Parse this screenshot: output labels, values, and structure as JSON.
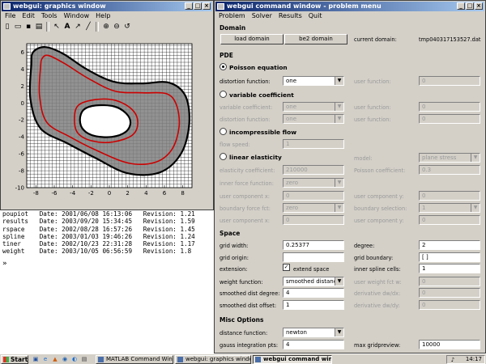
{
  "graphics_window": {
    "title": "webgui: graphics window",
    "menu": [
      "File",
      "Edit",
      "Tools",
      "Window",
      "Help"
    ],
    "toolbar_icons": [
      "new-file-icon",
      "open-folder-icon",
      "save-icon",
      "print-icon",
      "arrow-icon",
      "text-icon",
      "arrow-line-icon",
      "line-icon",
      "zoom-in-icon",
      "zoom-out-icon",
      "rotate-icon"
    ]
  },
  "command_window": {
    "rows": [
      "poupiot   Date: 2001/06/08 16:13:06   Revision: 1.21",
      "results   Date: 2003/09/20 15:34:45   Revision: 1.59",
      "rspace    Date: 2002/08/28 16:57:26   Revision: 1.45",
      "spline    Date: 2003/01/03 19:46:26   Revision: 1.24",
      "tiner     Date: 2002/10/23 22:31:28   Revision: 1.17",
      "weight    Date: 2003/10/05 06:56:59   Revision: 1.8"
    ],
    "prompt": "»"
  },
  "problem_menu": {
    "title": "webgui command window - problem menu",
    "menu": [
      "Problem",
      "Solver",
      "Results",
      "Quit"
    ],
    "domain": {
      "heading": "Domain",
      "load_button": "load domain",
      "be2_button": "be2 domain",
      "current_label": "current domain:",
      "current_value": "tmp040317153527.dat"
    },
    "pde": {
      "heading": "PDE",
      "poisson": {
        "label": "Poisson equation",
        "selected": true,
        "distortion_label": "distortion function:",
        "distortion_value": "one",
        "user_label": "user function:",
        "user_value": "0"
      },
      "variable": {
        "label": "variable coefficient",
        "selected": false,
        "coef_label": "variable coefficient:",
        "coef_value": "one",
        "distortion_label": "distortion function:",
        "distortion_value": "one",
        "user1_label": "user function:",
        "user1_value": "0",
        "user2_label": "user function:",
        "user2_value": "0"
      },
      "incompressible": {
        "label": "incompressible flow",
        "selected": false,
        "speed_label": "flow speed:",
        "speed_value": "1"
      },
      "elasticity": {
        "label": "linear elasticity",
        "selected": false,
        "model_label": "model:",
        "model_value": "plane stress",
        "coef_label": "elasticity coefficient:",
        "coef_value": "210000",
        "poisson_label": "Poisson coefficient:",
        "poisson_value": "0.3",
        "inner_label": "inner force function:",
        "inner_value": "zero",
        "ucx_label": "user component x:",
        "ucx_value": "0",
        "ucy_label": "user component y:",
        "ucy_value": "0",
        "boundary_label": "boundary force fct:",
        "boundary_value": "zero",
        "bsel_label": "boundary selection:",
        "bsel_value": "1",
        "ucx2_label": "user component x:",
        "ucx2_value": "0",
        "ucy2_label": "user component y:",
        "ucy2_value": "0"
      }
    },
    "space": {
      "heading": "Space",
      "grid_width_label": "grid width:",
      "grid_width_value": "0.25377",
      "degree_label": "degree:",
      "degree_value": "2",
      "grid_origin_label": "grid origin:",
      "grid_origin_value": "",
      "grid_boundary_label": "grid boundary:",
      "grid_boundary_value": "[ ]",
      "extension_label": "extension:",
      "extend_space_label": "extend space",
      "extend_checked": true,
      "inner_cells_label": "inner spline cells:",
      "inner_cells_value": "1",
      "weight_label": "weight function:",
      "weight_value": "smoothed distance",
      "user_weight_label": "user weight fct w:",
      "user_weight_value": "0",
      "smoothed_degree_label": "smoothed dist degree:",
      "smoothed_degree_value": "4",
      "deriv_x_label": "derivative dw/dx:",
      "deriv_x_value": "0",
      "smoothed_offset_label": "smoothed dist offset:",
      "smoothed_offset_value": "1",
      "deriv_y_label": "derivative dw/dy:",
      "deriv_y_value": "0"
    },
    "misc": {
      "heading": "Misc Options",
      "distance_label": "distance function:",
      "distance_value": "newton",
      "gauss_label": "gauss integration pts:",
      "gauss_value": "4",
      "max_grid_label": "max gridpreview:",
      "max_grid_value": "10000"
    }
  },
  "chart_data": {
    "type": "scatter",
    "title": "",
    "xlabel": "",
    "ylabel": "",
    "xlim": [
      -9,
      9
    ],
    "ylim": [
      -10,
      7
    ],
    "x_ticks": [
      -8,
      -6,
      -4,
      -2,
      0,
      2,
      4,
      6,
      8
    ],
    "y_ticks": [
      -10,
      -8,
      -6,
      -4,
      -2,
      0,
      2,
      4,
      6
    ],
    "grid": true,
    "outer_boundary": [
      [
        -8.5,
        4.5
      ],
      [
        -8.3,
        6.0
      ],
      [
        -7.0,
        6.6
      ],
      [
        -5.0,
        5.8
      ],
      [
        -2.5,
        4.0
      ],
      [
        0.5,
        2.5
      ],
      [
        3.5,
        2.3
      ],
      [
        6.5,
        2.4
      ],
      [
        8.3,
        0.8
      ],
      [
        8.7,
        -2.5
      ],
      [
        7.8,
        -6.0
      ],
      [
        5.5,
        -8.2
      ],
      [
        2.0,
        -8.3
      ],
      [
        -1.5,
        -6.5
      ],
      [
        -4.5,
        -4.8
      ],
      [
        -7.5,
        -3.0
      ],
      [
        -8.6,
        0.5
      ]
    ],
    "inner_boundary": [
      [
        -3.2,
        -2.0
      ],
      [
        -2.8,
        -0.8
      ],
      [
        -1.5,
        -0.3
      ],
      [
        0.5,
        -0.4
      ],
      [
        1.8,
        -1.2
      ],
      [
        2.3,
        -2.3
      ],
      [
        1.8,
        -3.4
      ],
      [
        0.3,
        -4.0
      ],
      [
        -1.6,
        -3.9
      ],
      [
        -2.8,
        -3.2
      ]
    ],
    "contour_outer": [
      [
        -7.5,
        4.2
      ],
      [
        -7.3,
        5.3
      ],
      [
        -6.6,
        5.6
      ],
      [
        -4.8,
        4.6
      ],
      [
        -2.3,
        2.9
      ],
      [
        0.6,
        1.4
      ],
      [
        3.6,
        1.2
      ],
      [
        6.2,
        1.1
      ],
      [
        7.3,
        -0.2
      ],
      [
        7.6,
        -2.8
      ],
      [
        6.8,
        -5.5
      ],
      [
        5.0,
        -7.0
      ],
      [
        2.1,
        -7.1
      ],
      [
        -1.4,
        -5.6
      ],
      [
        -4.3,
        -4.0
      ],
      [
        -6.8,
        -2.3
      ],
      [
        -7.6,
        0.8
      ]
    ],
    "contour_inner": [
      [
        -3.8,
        -2.0
      ],
      [
        -3.4,
        -0.3
      ],
      [
        -1.5,
        0.4
      ],
      [
        0.7,
        0.3
      ],
      [
        2.5,
        -0.8
      ],
      [
        3.1,
        -2.3
      ],
      [
        2.5,
        -3.8
      ],
      [
        0.4,
        -4.6
      ],
      [
        -1.8,
        -4.5
      ],
      [
        -3.4,
        -3.6
      ]
    ],
    "colors": {
      "fill": "#7f7f7f",
      "grid": "#000000",
      "contour": "#cc0000",
      "boundary": "#000000"
    }
  },
  "taskbar": {
    "start": "Start",
    "tasks": [
      "MATLAB Command Window",
      "webgui: graphics window",
      "webgui command win..."
    ],
    "active_task": 2,
    "clock": "14:17"
  }
}
